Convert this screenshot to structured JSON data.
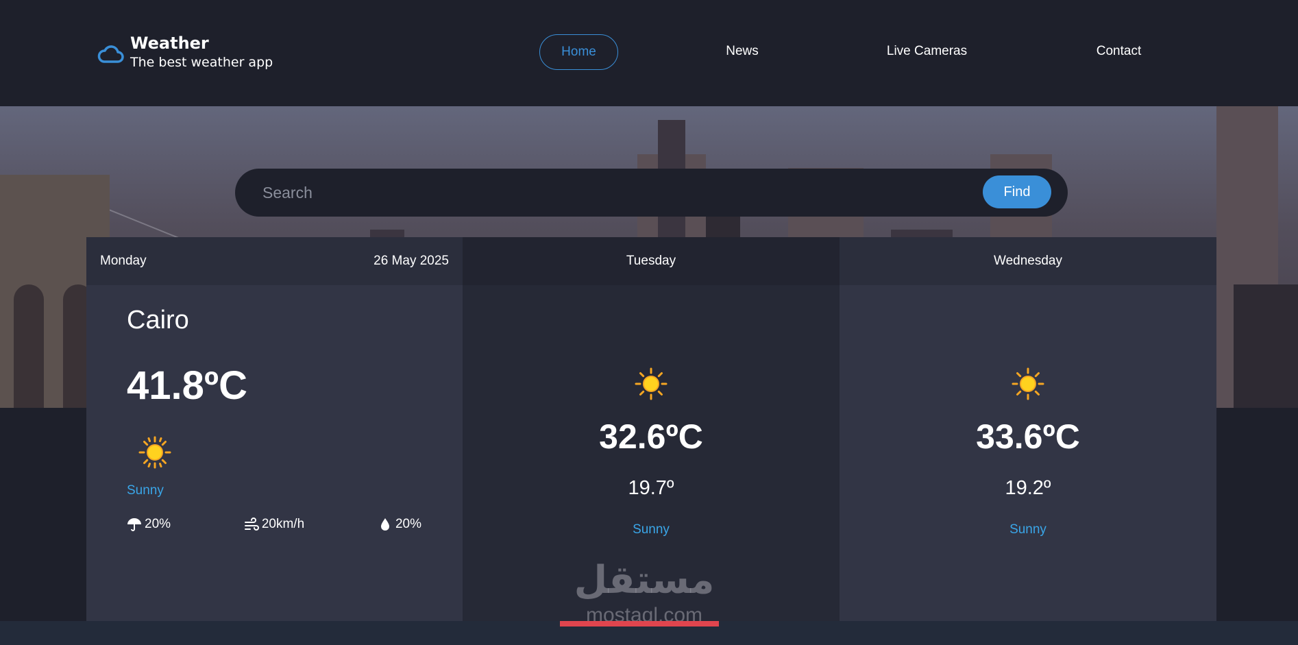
{
  "brand": {
    "title": "Weather",
    "subtitle": "The best weather app",
    "icon": "cloud-icon",
    "accent": "#3a8fd8"
  },
  "nav": [
    {
      "label": "Home",
      "active": true
    },
    {
      "label": "News",
      "active": false
    },
    {
      "label": "Live Cameras",
      "active": false
    },
    {
      "label": "Contact",
      "active": false
    }
  ],
  "search": {
    "placeholder": "Search",
    "button_label": "Find"
  },
  "today": {
    "day": "Monday",
    "date": "26 May 2025",
    "city": "Cairo",
    "temp": "41.8ºC",
    "icon": "sun-icon",
    "condition": "Sunny",
    "rain": "20%",
    "wind": "20km/h",
    "humidity": "20%"
  },
  "forecast": [
    {
      "day": "Tuesday",
      "icon": "sun-icon",
      "max": "32.6ºC",
      "min": "19.7º",
      "condition": "Sunny"
    },
    {
      "day": "Wednesday",
      "icon": "sun-icon",
      "max": "33.6ºC",
      "min": "19.2º",
      "condition": "Sunny"
    }
  ],
  "watermark": {
    "arabic": "مستقل",
    "latin": "mostaql.com"
  },
  "colors": {
    "background": "#1e202b",
    "card": "#323545",
    "card_alt": "#262936",
    "condition": "#3aa6e8"
  }
}
